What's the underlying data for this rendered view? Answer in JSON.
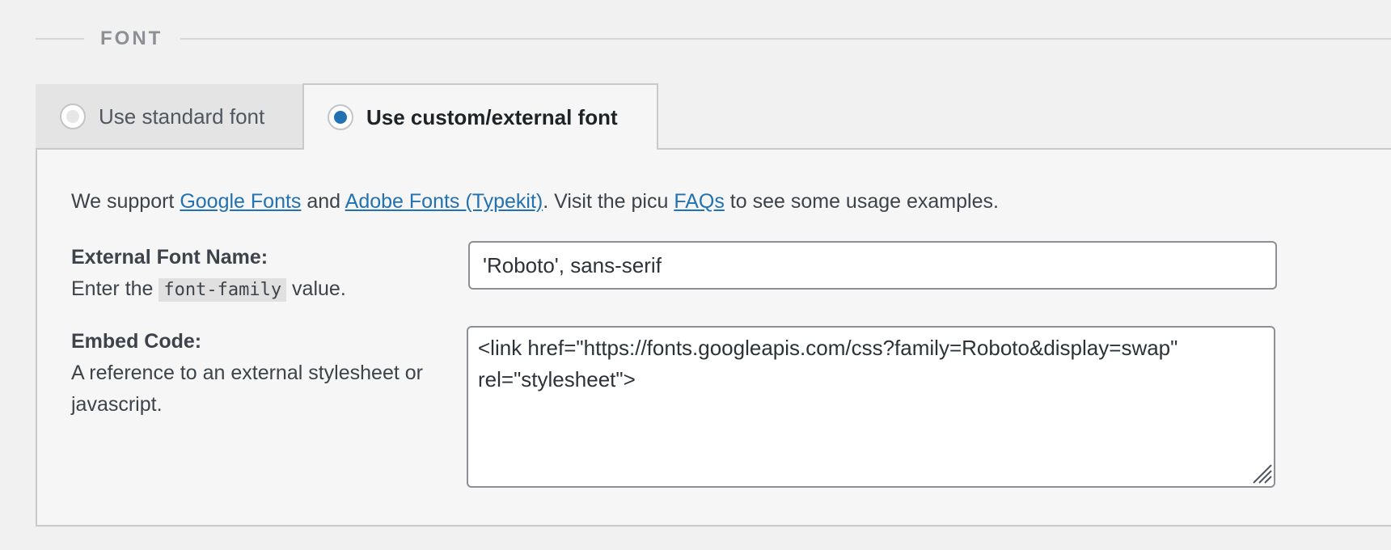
{
  "section": {
    "title": "FONT"
  },
  "tabs": [
    {
      "label": "Use standard font",
      "selected": false
    },
    {
      "label": "Use custom/external font",
      "selected": true
    }
  ],
  "intro": {
    "prefix": "We support ",
    "link_google": "Google Fonts",
    "and": " and ",
    "link_adobe": "Adobe Fonts (Typekit)",
    "middle": ". Visit the picu ",
    "link_faqs": "FAQs",
    "suffix": " to see some usage examples."
  },
  "external_font": {
    "title": "External Font Name:",
    "desc_prefix": "Enter the ",
    "desc_code": "font-family",
    "desc_suffix": " value.",
    "value": "'Roboto', sans-serif"
  },
  "embed_code": {
    "title": "Embed Code:",
    "desc": "A reference to an external stylesheet or javascript.",
    "value": "<link href=\"https://fonts.googleapis.com/css?family=Roboto&display=swap\" rel=\"stylesheet\">"
  },
  "colors": {
    "link": "#2271b1",
    "radio_selected": "#2271b1",
    "background": "#f1f1f1",
    "panel": "#f6f6f6"
  }
}
